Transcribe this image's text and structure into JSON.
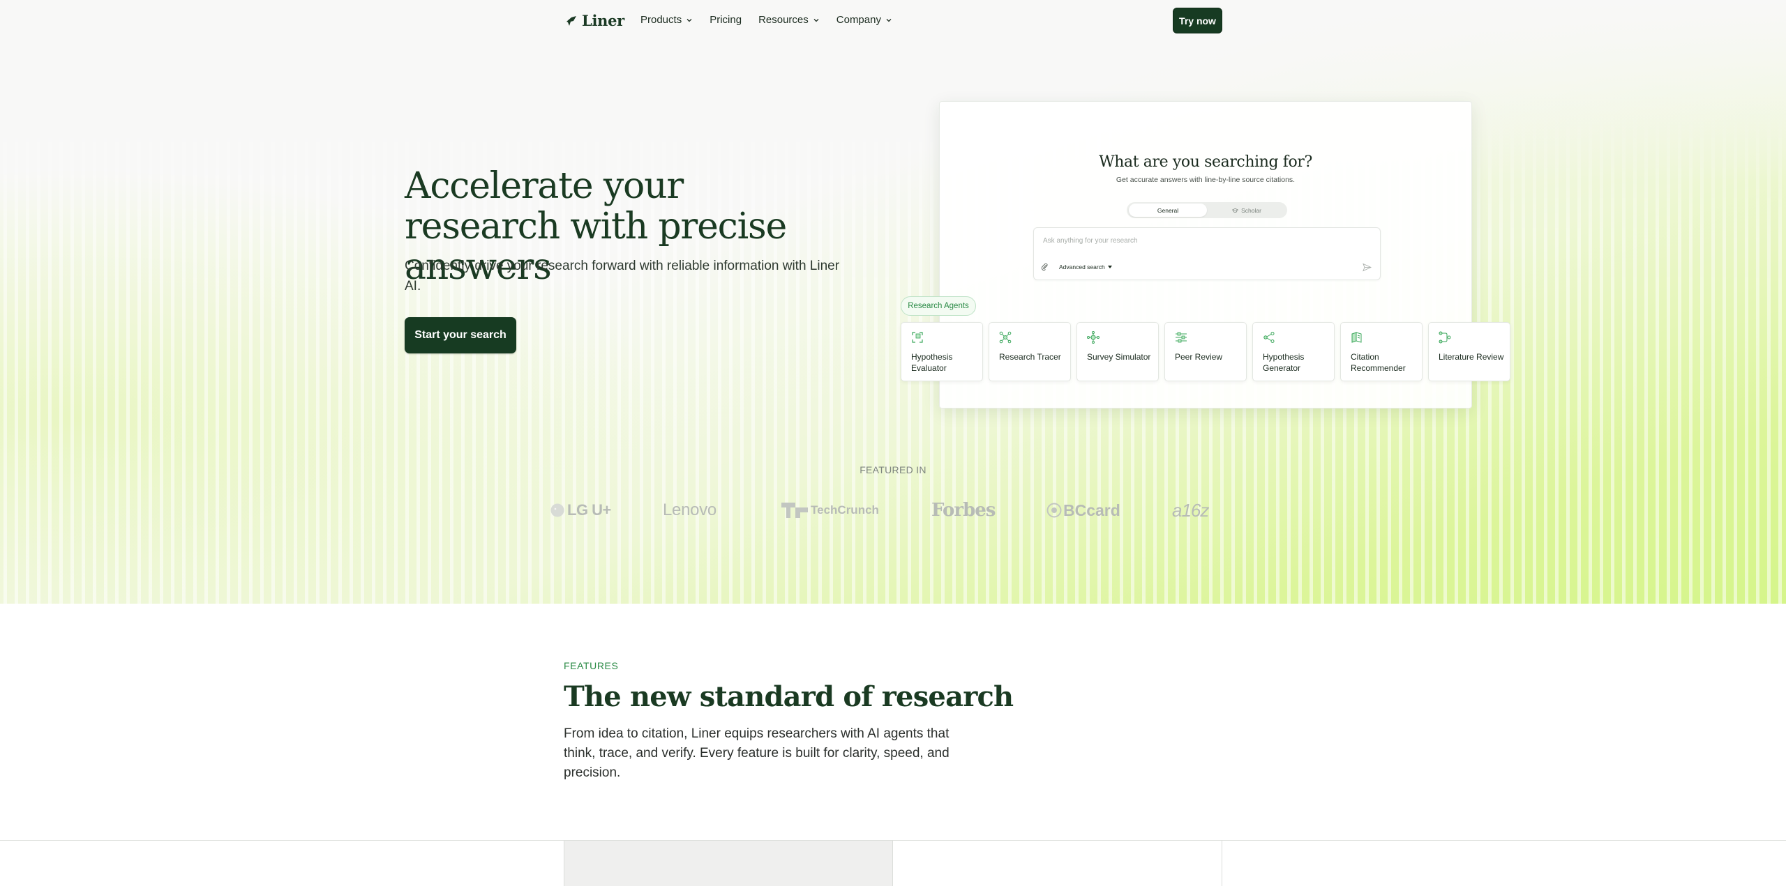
{
  "brand": {
    "name": "Liner",
    "color": "#173b22",
    "accent": "#2a8a45"
  },
  "nav": {
    "items": [
      {
        "label": "Products",
        "dropdown": true
      },
      {
        "label": "Pricing",
        "dropdown": false
      },
      {
        "label": "Resources",
        "dropdown": true
      },
      {
        "label": "Company",
        "dropdown": true
      }
    ],
    "cta": "Try now"
  },
  "hero": {
    "title": "Accelerate your research with precise answers",
    "subtitle": "Confidently drive your research forward with reliable information with Liner AI.",
    "cta": "Start your search"
  },
  "mockup": {
    "title": "What are you searching for?",
    "subtitle": "Get accurate answers with line-by-line source citations.",
    "tabs": [
      "General",
      "Scholar"
    ],
    "placeholder": "Ask anything for your research",
    "advanced": "Advanced search",
    "agents_label": "Research Agents",
    "agents": [
      {
        "label": "Hypothesis Evaluator",
        "icon": "expand-icon"
      },
      {
        "label": "Research Tracer",
        "icon": "network-icon"
      },
      {
        "label": "Survey Simulator",
        "icon": "molecule-icon"
      },
      {
        "label": "Peer Review",
        "icon": "sliders-icon"
      },
      {
        "label": "Hypothesis Generator",
        "icon": "share-nodes-icon"
      },
      {
        "label": "Citation Recommender",
        "icon": "book-icon"
      },
      {
        "label": "Literature Review",
        "icon": "flow-icon"
      }
    ]
  },
  "featured": {
    "label": "FEATURED IN",
    "logos": [
      "LG U+",
      "Lenovo",
      "TechCrunch",
      "Forbes",
      "BCcard",
      "a16z"
    ]
  },
  "features": {
    "eyebrow": "FEATURES",
    "title": "The new standard of research",
    "description": "From idea to citation, Liner equips researchers with AI agents that think, trace, and verify. Every feature is built for clarity, speed, and precision."
  }
}
